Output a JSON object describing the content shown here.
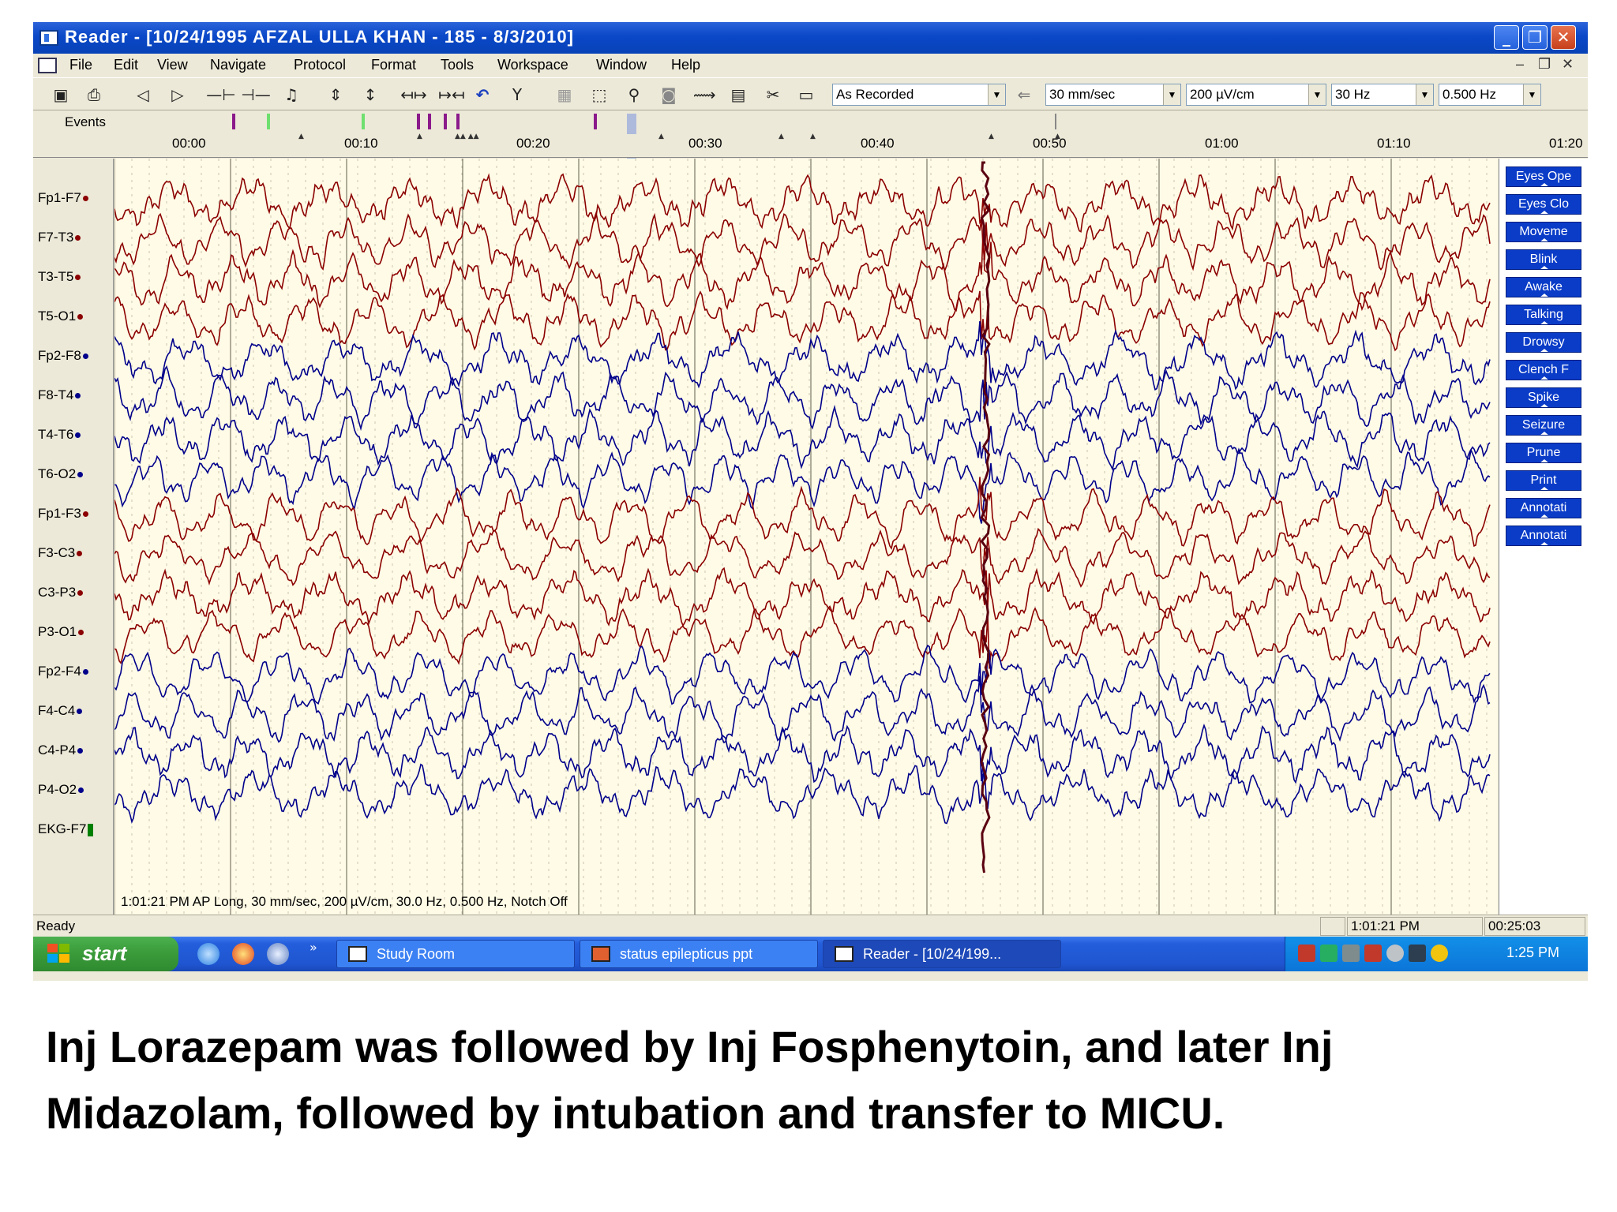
{
  "window": {
    "title": "Reader - [10/24/1995 AFZAL ULLA KHAN - 185 - 8/3/2010]",
    "minimize_glyph": "_",
    "restore_glyph": "❐",
    "close_glyph": "✕"
  },
  "menu": [
    "File",
    "Edit",
    "View",
    "Navigate",
    "Protocol",
    "Format",
    "Tools",
    "Workspace",
    "Window",
    "Help"
  ],
  "toolbar": {
    "montage": "As Recorded",
    "speed": "30 mm/sec",
    "sensitivity": "200 µV/cm",
    "high_filter": "30 Hz",
    "low_filter": "0.500 Hz"
  },
  "events_label": "Events",
  "time_ticks": [
    "00:00",
    "00:10",
    "00:20",
    "00:30",
    "00:40",
    "00:50",
    "01:00",
    "01:10",
    "01:20"
  ],
  "channels": [
    {
      "label": "Fp1-F7",
      "color": "#8b0000"
    },
    {
      "label": "F7-T3",
      "color": "#8b0000"
    },
    {
      "label": "T3-T5",
      "color": "#8b0000"
    },
    {
      "label": "T5-O1",
      "color": "#8b0000"
    },
    {
      "label": "Fp2-F8",
      "color": "#00008b"
    },
    {
      "label": "F8-T4",
      "color": "#00008b"
    },
    {
      "label": "T4-T6",
      "color": "#00008b"
    },
    {
      "label": "T6-O2",
      "color": "#00008b"
    },
    {
      "label": "Fp1-F3",
      "color": "#8b0000"
    },
    {
      "label": "F3-C3",
      "color": "#8b0000"
    },
    {
      "label": "C3-P3",
      "color": "#8b0000"
    },
    {
      "label": "P3-O1",
      "color": "#8b0000"
    },
    {
      "label": "Fp2-F4",
      "color": "#00008b"
    },
    {
      "label": "F4-C4",
      "color": "#00008b"
    },
    {
      "label": "C4-P4",
      "color": "#00008b"
    },
    {
      "label": "P4-O2",
      "color": "#00008b"
    },
    {
      "label": "EKG-F7",
      "color": "#008000"
    }
  ],
  "event_buttons": [
    "Eyes Ope",
    "Eyes Clo",
    "Moveme",
    "Blink",
    "Awake",
    "Talking",
    "Drowsy",
    "Clench F",
    "Spike",
    "Seizure",
    "Prune",
    "Print",
    "Annotati",
    "Annotati"
  ],
  "trace_status": "1:01:21 PM AP Long, 30 mm/sec, 200 µV/cm, 30.0 Hz, 0.500 Hz, Notch Off",
  "statusbar": {
    "ready": "Ready",
    "clock_time": "1:01:21 PM",
    "elapsed": "00:25:03"
  },
  "taskbar": {
    "start": "start",
    "tasks": [
      "Study Room",
      "status epilepticus ppt",
      "Reader - [10/24/199..."
    ],
    "more_glyph": "»",
    "clock": "1:25 PM"
  },
  "caption": "Inj Lorazepam was followed by Inj Fosphenytoin, and later Inj Midazolam, followed by intubation and transfer to MICU.",
  "colors": {
    "title_blue": "#0842b6",
    "trace_red": "#8b0000",
    "trace_blue": "#00008b",
    "background": "#fffbe6",
    "button_blue": "#0a3cc8"
  }
}
